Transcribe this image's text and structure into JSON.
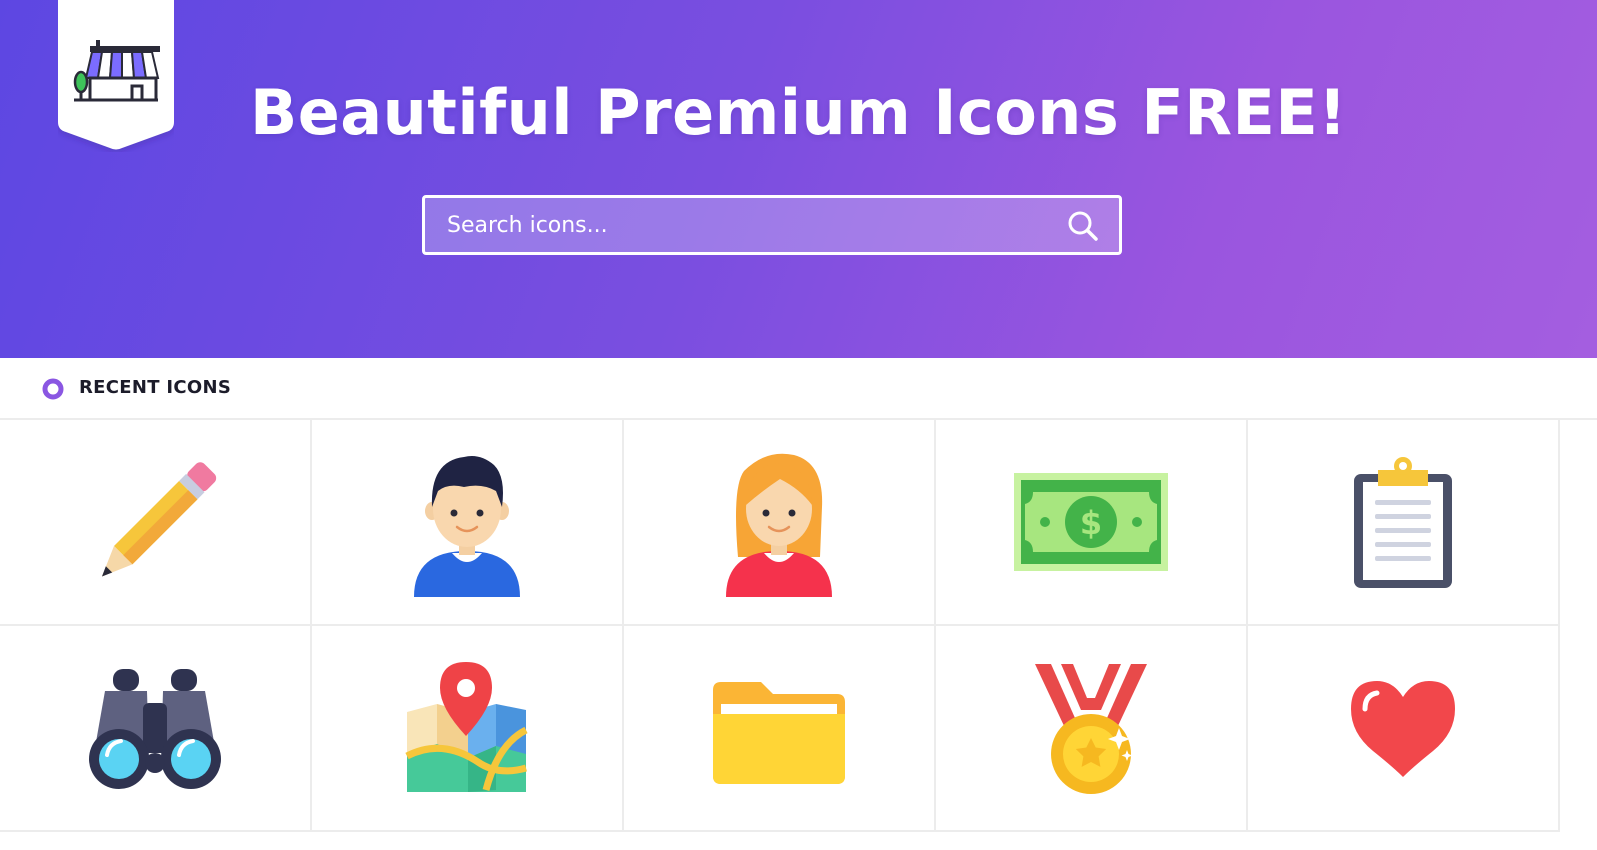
{
  "brand": {
    "logo_icon": "storefront-icon"
  },
  "hero": {
    "title": "Beautiful Premium Icons FREE!",
    "search": {
      "placeholder": "Search icons...",
      "value": "",
      "icon": "search-icon"
    },
    "gradient": [
      "#5d47e2",
      "#a45ee0"
    ]
  },
  "recent": {
    "title": "RECENT ICONS",
    "marker_color": "#8a56e2",
    "icons": [
      "pencil-icon",
      "boy-avatar-icon",
      "girl-avatar-icon",
      "dollar-bill-icon",
      "clipboard-icon",
      "binoculars-icon",
      "map-pin-icon",
      "folder-icon",
      "medal-icon",
      "heart-icon"
    ]
  }
}
